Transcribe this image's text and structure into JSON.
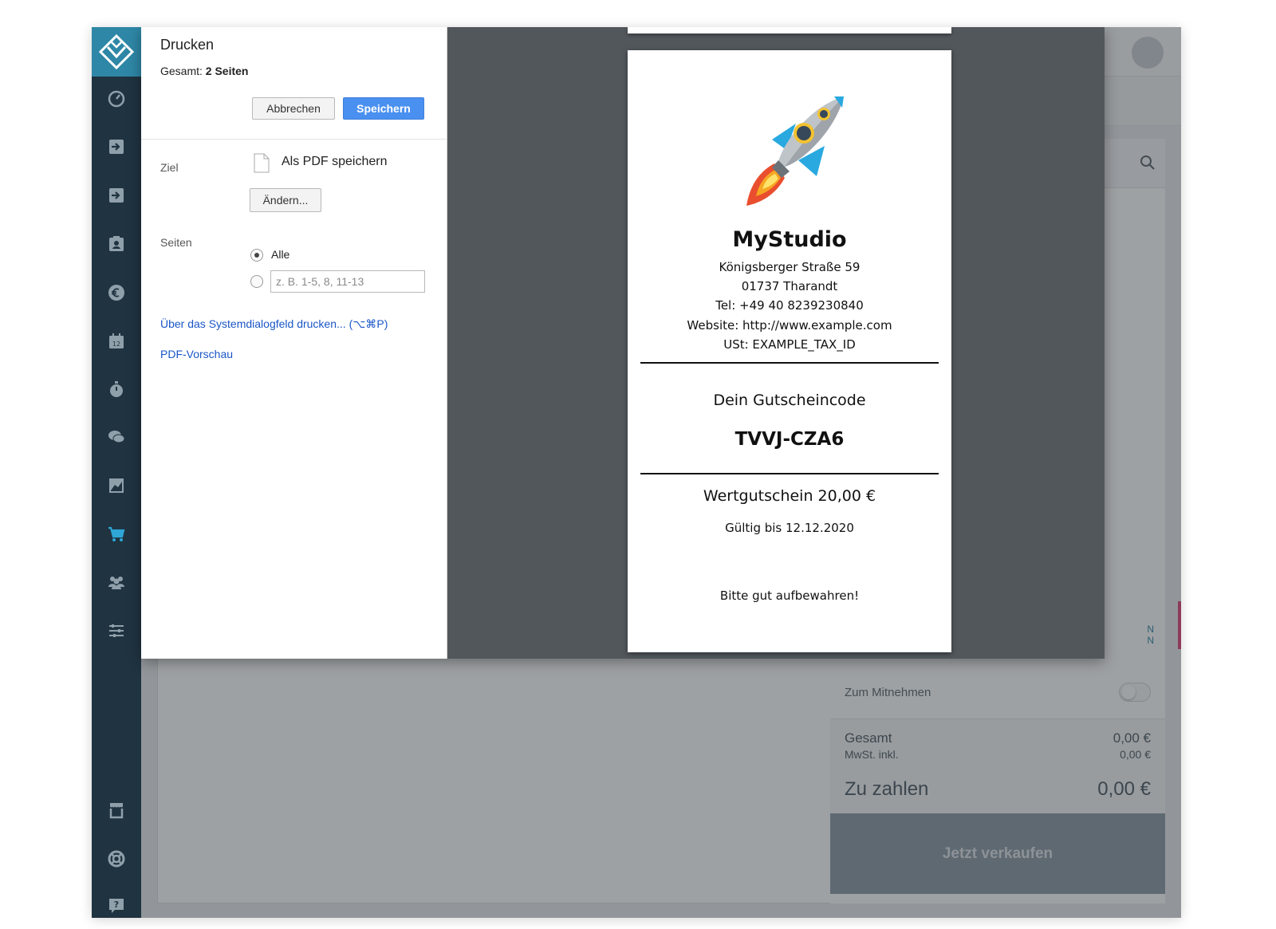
{
  "print_dialog": {
    "title": "Drucken",
    "total_prefix": "Gesamt:",
    "total_pages": "2 Seiten",
    "cancel_label": "Abbrechen",
    "save_label": "Speichern",
    "destination_label": "Ziel",
    "destination_value": "Als PDF speichern",
    "change_label": "Ändern...",
    "pages_label": "Seiten",
    "pages_all_label": "Alle",
    "pages_range_placeholder": "z. B. 1-5, 8, 11-13",
    "system_dialog_link": "Über das Systemdialogfeld drucken... (⌥⌘P)",
    "pdf_preview_link": "PDF-Vorschau"
  },
  "receipt": {
    "business_name": "MyStudio",
    "street": "Königsberger Straße 59",
    "city": "01737 Tharandt",
    "phone": "Tel: +49 40 8239230840",
    "website": "Website: http://www.example.com",
    "tax_id": "USt: EXAMPLE_TAX_ID",
    "voucher_heading": "Dein Gutscheincode",
    "voucher_code": "TVVJ-CZA6",
    "voucher_value": "Wertgutschein 20,00 €",
    "valid_until": "Gültig bis 12.12.2020",
    "keep_note": "Bitte gut aufbewahren!"
  },
  "pos": {
    "takeaway_label": "Zum Mitnehmen",
    "total_label": "Gesamt",
    "total_value": "0,00 €",
    "vat_label": "MwSt. inkl.",
    "vat_value": "0,00 €",
    "to_pay_label": "Zu zahlen",
    "to_pay_value": "0,00 €",
    "sell_button_label": "Jetzt verkaufen",
    "partial_tab_text": "N"
  },
  "colors": {
    "sidebar_bg": "#1f3340",
    "logo_bg": "#2e87a6",
    "active_nav": "#2ea6d6",
    "save_button": "#4a90f0",
    "link": "#1a56c7",
    "preview_bg": "#52575c"
  },
  "nav_icons": [
    "dashboard-icon",
    "sign-in-icon",
    "sign-in-alt-icon",
    "contacts-icon",
    "euro-icon",
    "calendar-icon",
    "timer-icon",
    "chat-icon",
    "chart-icon",
    "cart-icon",
    "users-icon",
    "settings-sliders-icon",
    "store-icon",
    "lifebuoy-icon",
    "help-icon"
  ]
}
